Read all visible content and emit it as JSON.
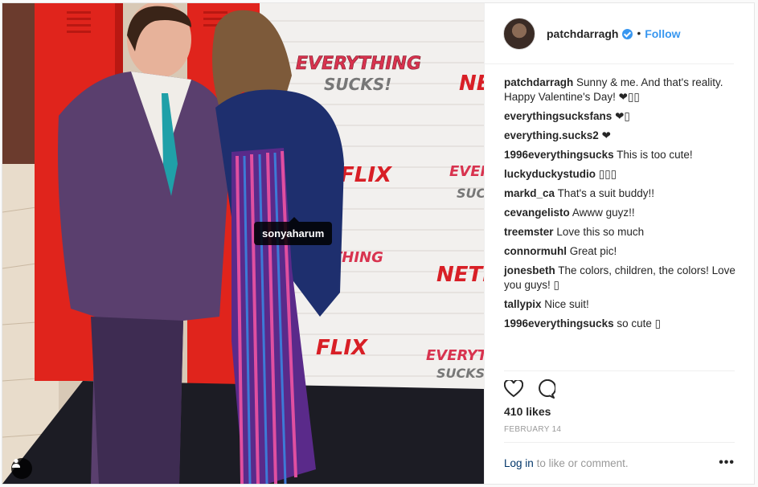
{
  "photo": {
    "tag_label": "sonyaharum",
    "backdrop_texts": [
      "EVERYTHING",
      "SUCKS!",
      "NETFLIX",
      "FLIX",
      "EVERYTH",
      "SUCKS",
      "THING"
    ],
    "colors": {
      "wall": "#f2f0ee",
      "locker": "#e0241c",
      "netflix_red": "#d81f26"
    }
  },
  "header": {
    "username": "patchdarragh",
    "separator": "•",
    "follow_label": "Follow"
  },
  "comments": [
    {
      "user": "patchdarragh",
      "text": "Sunny & me. And that's reality. Happy Valentine's Day! ❤▯▯"
    },
    {
      "user": "everythingsucksfans",
      "text": "❤▯"
    },
    {
      "user": "everything.sucks2",
      "text": "❤"
    },
    {
      "user": "1996everythingsucks",
      "text": "This is too cute!"
    },
    {
      "user": "luckyduckystudio",
      "text": "▯▯▯"
    },
    {
      "user": "markd_ca",
      "text": "That's a suit buddy!!"
    },
    {
      "user": "cevangelisto",
      "text": "Awww guyz!!"
    },
    {
      "user": "treemster",
      "text": "Love this so much"
    },
    {
      "user": "connormuhl",
      "text": "Great pic!"
    },
    {
      "user": "jonesbeth",
      "text": "The colors, children, the colors! Love you guys! ▯"
    },
    {
      "user": "tallypix",
      "text": "Nice suit!"
    },
    {
      "user": "1996everythingsucks",
      "text": "so cute ▯"
    }
  ],
  "actions": {
    "like_icon": "heart-icon",
    "comment_icon": "comment-icon"
  },
  "likes": "410 likes",
  "date": "FEBRUARY 14",
  "footer": {
    "login_link": "Log in",
    "login_rest": "to like or comment.",
    "more_label": "•••"
  },
  "accent": "#3897f0"
}
